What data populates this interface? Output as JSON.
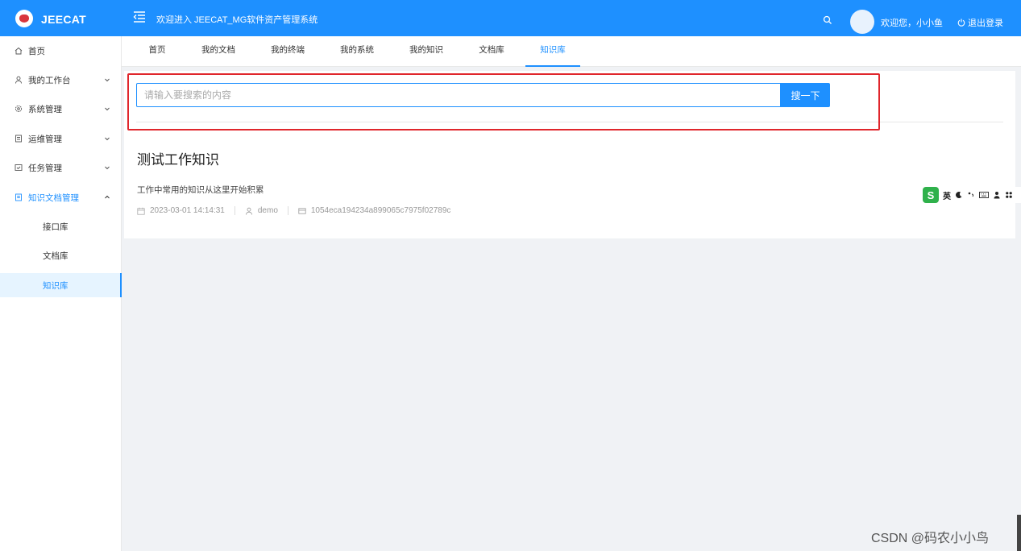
{
  "header": {
    "logo_text": "JEECAT",
    "title": "欢迎进入 JEECAT_MG软件资产管理系统",
    "welcome": "欢迎您，小小鱼",
    "logout": "退出登录",
    "brand_color": "#1e90ff"
  },
  "sidebar": {
    "items": [
      {
        "label": "首页",
        "icon": "home-icon"
      },
      {
        "label": "我的工作台",
        "icon": "user-icon"
      },
      {
        "label": "系统管理",
        "icon": "gear-icon"
      },
      {
        "label": "运维管理",
        "icon": "server-icon"
      },
      {
        "label": "任务管理",
        "icon": "task-icon"
      },
      {
        "label": "知识文档管理",
        "icon": "doc-icon"
      }
    ],
    "sub_items": [
      {
        "label": "接口库"
      },
      {
        "label": "文档库"
      },
      {
        "label": "知识库"
      }
    ]
  },
  "tabs": [
    "首页",
    "我的文档",
    "我的终端",
    "我的系统",
    "我的知识",
    "文档库",
    "知识库"
  ],
  "active_tab": "知识库",
  "search": {
    "placeholder": "请输入要搜索的内容",
    "button": "搜一下"
  },
  "knowledge": {
    "title": "测试工作知识",
    "description": "工作中常用的知识从这里开始积累",
    "date": "2023-03-01 14:14:31",
    "author": "demo",
    "id": "1054eca194234a899065c7975f02789c"
  },
  "ime": {
    "lang": "英"
  },
  "watermark": "CSDN @码农小小鸟"
}
